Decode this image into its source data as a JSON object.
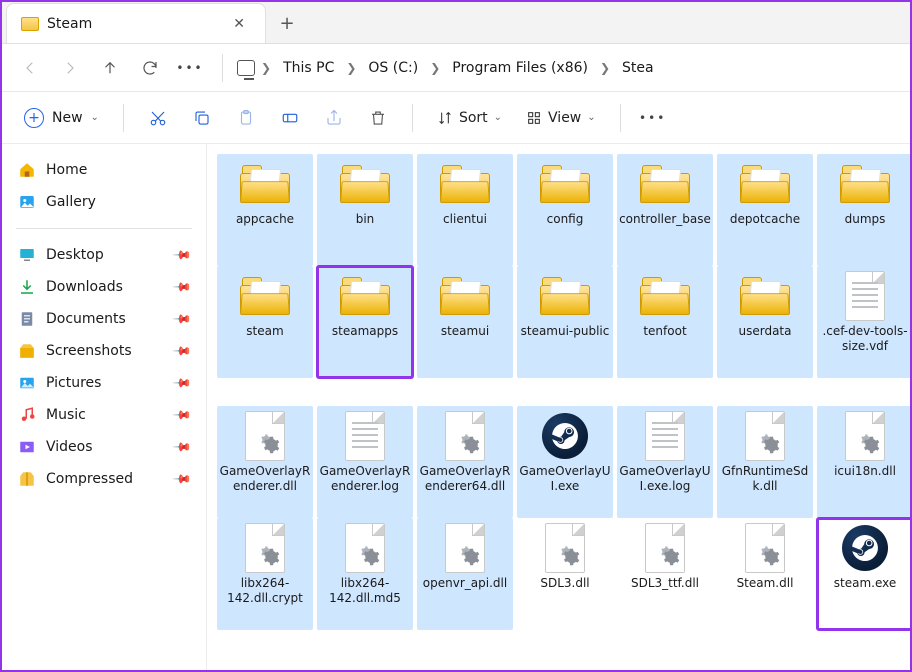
{
  "tab": {
    "title": "Steam"
  },
  "breadcrumb": [
    {
      "label": "This PC"
    },
    {
      "label": "OS (C:)"
    },
    {
      "label": "Program Files (x86)"
    },
    {
      "label": "Stea"
    }
  ],
  "toolbar": {
    "new_label": "New",
    "sort_label": "Sort",
    "view_label": "View"
  },
  "sidebar": {
    "top": [
      {
        "key": "home",
        "label": "Home"
      },
      {
        "key": "gallery",
        "label": "Gallery"
      }
    ],
    "pinned": [
      {
        "key": "desktop",
        "label": "Desktop"
      },
      {
        "key": "downloads",
        "label": "Downloads"
      },
      {
        "key": "documents",
        "label": "Documents"
      },
      {
        "key": "screenshots",
        "label": "Screenshots"
      },
      {
        "key": "pictures",
        "label": "Pictures"
      },
      {
        "key": "music",
        "label": "Music"
      },
      {
        "key": "videos",
        "label": "Videos"
      },
      {
        "key": "compressed",
        "label": "Compressed"
      }
    ]
  },
  "rows": [
    [
      {
        "name": "appcache",
        "type": "folder",
        "selected": true
      },
      {
        "name": "bin",
        "type": "folder",
        "selected": true
      },
      {
        "name": "clientui",
        "type": "folder",
        "selected": true
      },
      {
        "name": "config",
        "type": "folder",
        "selected": true
      },
      {
        "name": "controller_base",
        "type": "folder",
        "selected": true
      },
      {
        "name": "depotcache",
        "type": "folder",
        "selected": true
      },
      {
        "name": "dumps",
        "type": "folder",
        "selected": true
      }
    ],
    [
      {
        "name": "steam",
        "type": "folder",
        "selected": true
      },
      {
        "name": "steamapps",
        "type": "folder",
        "selected": true,
        "highlighted": true
      },
      {
        "name": "steamui",
        "type": "folder",
        "selected": true
      },
      {
        "name": "steamui-public",
        "type": "folder",
        "selected": true
      },
      {
        "name": "tenfoot",
        "type": "folder",
        "selected": true
      },
      {
        "name": "userdata",
        "type": "folder",
        "selected": true
      },
      {
        "name": ".cef-dev-tools-size.vdf",
        "type": "textfile",
        "selected": true
      }
    ],
    [
      {
        "name": "GameOverlayRenderer.dll",
        "type": "dll",
        "selected": true
      },
      {
        "name": "GameOverlayRenderer.log",
        "type": "textfile",
        "selected": true
      },
      {
        "name": "GameOverlayRenderer64.dll",
        "type": "dll",
        "selected": true
      },
      {
        "name": "GameOverlayUI.exe",
        "type": "steam",
        "selected": true
      },
      {
        "name": "GameOverlayUI.exe.log",
        "type": "textfile",
        "selected": true
      },
      {
        "name": "GfnRuntimeSdk.dll",
        "type": "dll",
        "selected": true
      },
      {
        "name": "icui18n.dll",
        "type": "dll",
        "selected": true
      }
    ],
    [
      {
        "name": "libx264-142.dll.crypt",
        "type": "dll",
        "selected": true
      },
      {
        "name": "libx264-142.dll.md5",
        "type": "dll",
        "selected": true
      },
      {
        "name": "openvr_api.dll",
        "type": "dll",
        "selected": true
      },
      {
        "name": "SDL3.dll",
        "type": "dll",
        "selected": false
      },
      {
        "name": "SDL3_ttf.dll",
        "type": "dll",
        "selected": false
      },
      {
        "name": "Steam.dll",
        "type": "dll",
        "selected": false
      },
      {
        "name": "steam.exe",
        "type": "steam",
        "selected": false,
        "highlighted": true
      }
    ]
  ]
}
